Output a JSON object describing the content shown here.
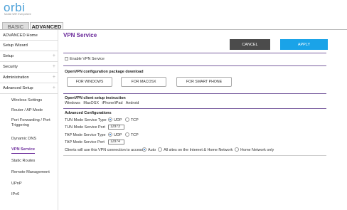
{
  "header": {
    "logo": "orbi",
    "tagline": "Mobile WiFi Everywhere",
    "tabs": [
      {
        "label": "BASIC"
      },
      {
        "label": "ADVANCED"
      }
    ],
    "active_tab": "ADVANCED"
  },
  "sidebar": {
    "main_items": [
      {
        "label": "ADVANCED Home",
        "expandable": false
      },
      {
        "label": "Setup Wizard",
        "expandable": false
      },
      {
        "label": "Setup",
        "expandable": true
      },
      {
        "label": "Security",
        "expandable": true
      },
      {
        "label": "Administration",
        "expandable": true
      },
      {
        "label": "Advanced Setup",
        "expandable": true
      }
    ],
    "sub_items": [
      {
        "label": "Wireless Settings"
      },
      {
        "label": "Router / AP Mode"
      },
      {
        "label": "Port Forwarding / Port Triggering"
      },
      {
        "label": "Dynamic DNS"
      },
      {
        "label": "VPN Service"
      },
      {
        "label": "Static Routes"
      },
      {
        "label": "Remote Management"
      },
      {
        "label": "UPnP"
      },
      {
        "label": "IPv6"
      }
    ],
    "active_item": "VPN Service",
    "expand_glyph": "+"
  },
  "page": {
    "title": "VPN Service",
    "cancel_label": "CANCEL",
    "apply_label": "APPLY",
    "enable_label": "Enable VPN Service",
    "enable_checked": false
  },
  "download": {
    "heading": "OpenVPN configuration package download",
    "buttons": [
      {
        "label": "FOR WINDOWS"
      },
      {
        "label": "FOR MACOSX"
      },
      {
        "label": "FOR SMART PHONE"
      }
    ]
  },
  "client": {
    "heading": "OpenVPN client setup instruction",
    "links": [
      "Windows",
      "MacOSX",
      "iPhone/iPad",
      "Android"
    ]
  },
  "advanced": {
    "heading": "Advanced Configurations",
    "tun_type_label": "TUN Mode Service Type",
    "tun_type_value": "UDP",
    "tun_port_label": "TUN Mode Service Port",
    "tun_port_value": "12973",
    "tap_type_label": "TAP Mode Service Type",
    "tap_type_value": "UDP",
    "tap_port_label": "TAP Mode Service Port",
    "tap_port_value": "12974",
    "protocol_options": [
      "UDP",
      "TCP"
    ],
    "access_label": "Clients will use this VPN connection to access",
    "access_options": [
      "Auto",
      "All sites on the Internet & Home Network",
      "Home Network only"
    ],
    "access_value": "Auto"
  },
  "colors": {
    "accent_purple": "#6a2a9a",
    "apply_blue": "#1aa3e8",
    "cancel_gray": "#4b4b4b",
    "logo_blue": "#4aa0d8"
  }
}
